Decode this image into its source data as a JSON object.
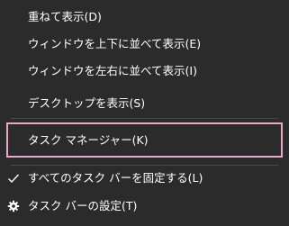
{
  "context_menu": {
    "items": [
      {
        "label": "重ねて表示(D)"
      },
      {
        "label": "ウィンドウを上下に並べて表示(E)"
      },
      {
        "label": "ウィンドウを左右に並べて表示(I)"
      },
      {
        "label": "デスクトップを表示(S)"
      },
      {
        "label": "タスク マネージャー(K)"
      },
      {
        "label": "すべてのタスク バーを固定する(L)",
        "checked": true,
        "icon": "check-icon"
      },
      {
        "label": "タスク バーの設定(T)",
        "icon": "gear-icon"
      }
    ],
    "colors": {
      "background": "#2b2b2b",
      "text": "#ffffff",
      "highlight_border": "#e6a9c9",
      "separator": "#4a4a4a"
    }
  }
}
